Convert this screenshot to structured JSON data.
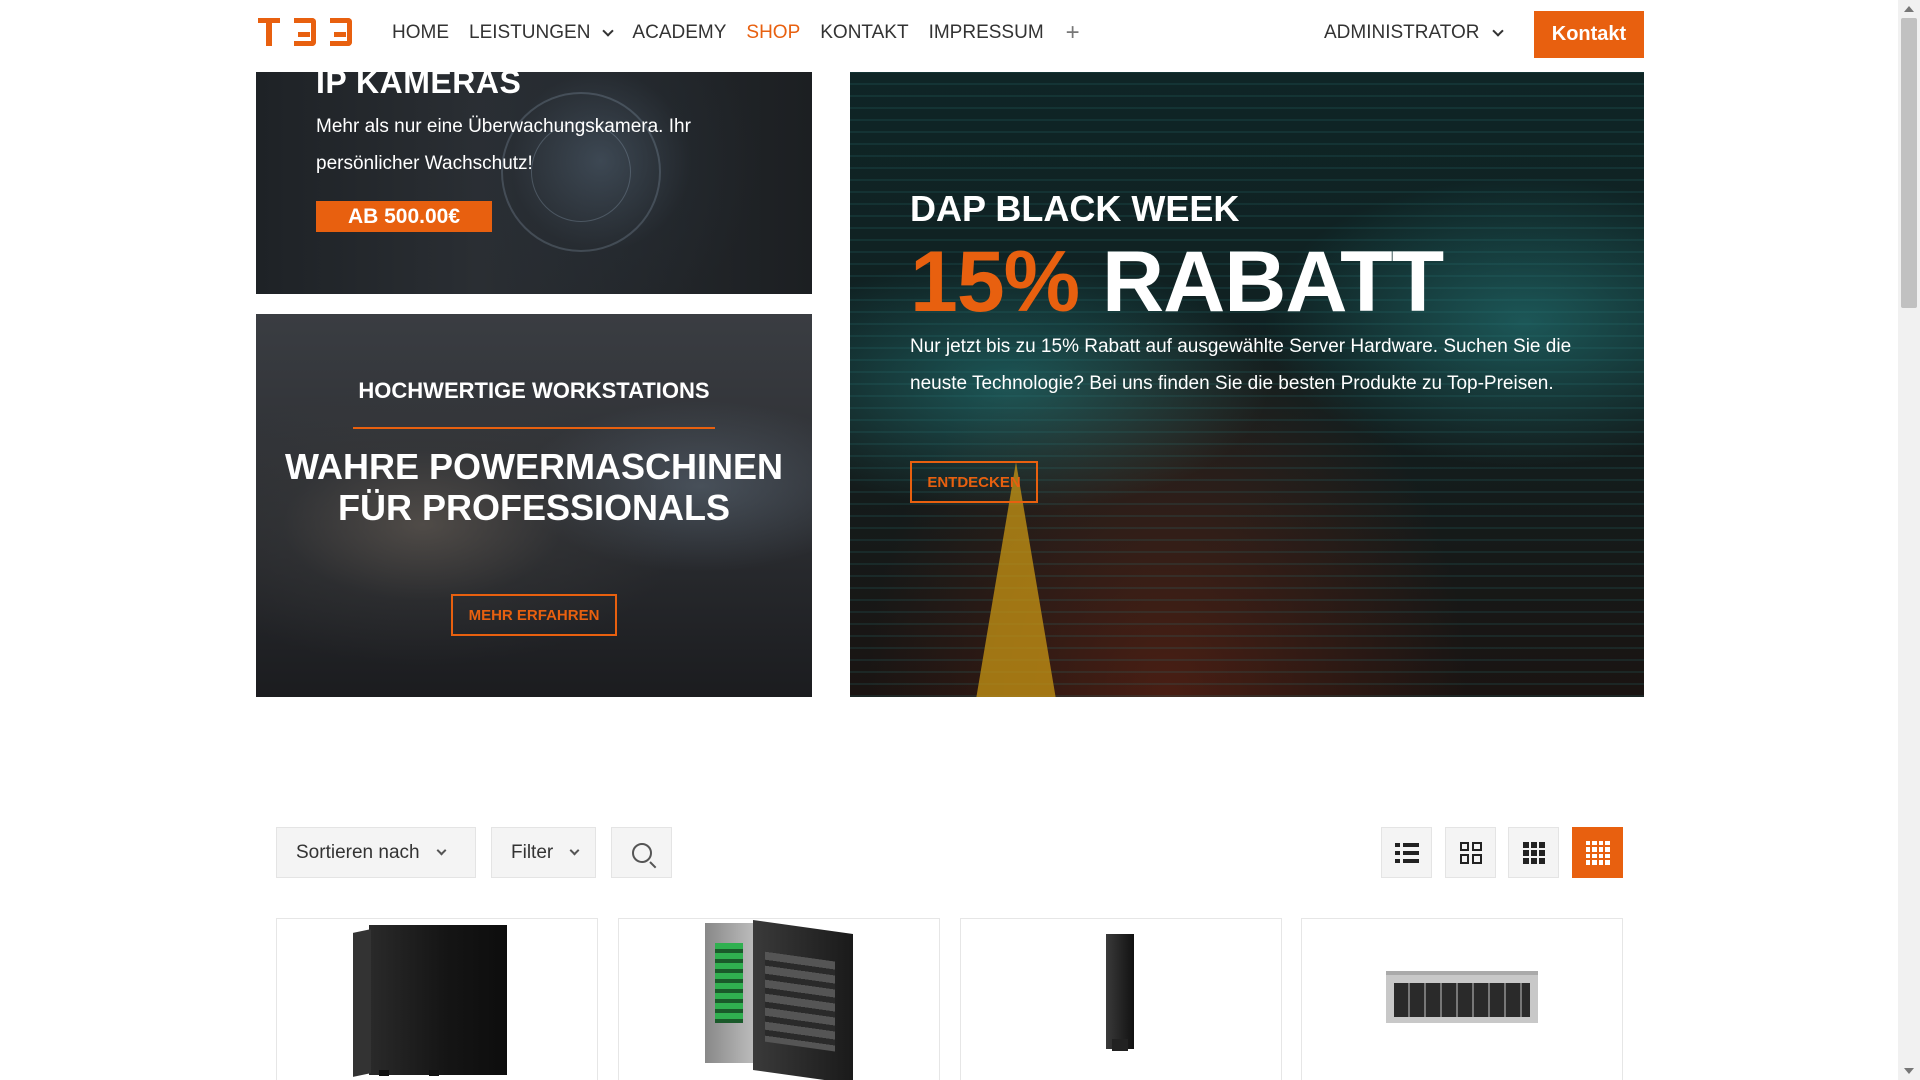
{
  "header": {
    "logo_text": "TBB",
    "nav": [
      {
        "label": "HOME"
      },
      {
        "label": "LEISTUNGEN"
      },
      {
        "label": "ACADEMY"
      },
      {
        "label": "SHOP"
      },
      {
        "label": "KONTAKT"
      },
      {
        "label": "IMPRESSUM"
      }
    ],
    "plus_symbol": "+",
    "user_menu": "ADMINISTRATOR",
    "contact_button": "Kontakt"
  },
  "banners": {
    "ip_cameras": {
      "title": "IP KAMERAS",
      "text": "Mehr als nur eine Überwachungskamera. Ihr persönlicher Wachschutz!",
      "price_badge": "AB 500.00€"
    },
    "workstations": {
      "title": "HOCHWERTIGE WORKSTATIONS",
      "headline": "WAHRE POWERMASCHINEN FÜR PROFESSIONALS",
      "button": "MEHR ERFAHREN"
    },
    "black_week": {
      "subtitle": "DAP BLACK WEEK",
      "discount": "15%",
      "discount_word": "RABATT",
      "text": "Nur jetzt bis zu 15% Rabatt auf ausgewählte Server Hardware. Suchen Sie die neuste Technologie? Bei uns finden Sie die besten Produkte zu Top-Preisen.",
      "button": "ENTDECKEN"
    }
  },
  "toolbar": {
    "sort_label": "Sortieren nach",
    "filter_label": "Filter",
    "view_modes": [
      "list",
      "grid-2",
      "grid-3",
      "grid-4"
    ],
    "active_view": "grid-4"
  },
  "colors": {
    "accent": "#e8600f",
    "text": "#333333"
  }
}
